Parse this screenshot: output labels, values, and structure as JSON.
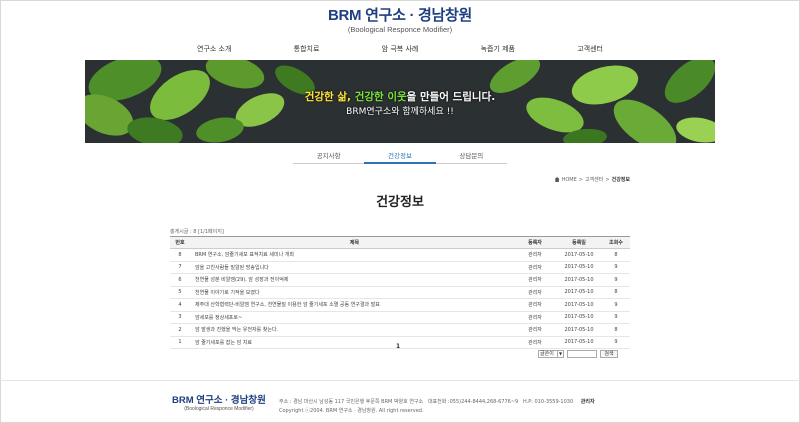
{
  "header": {
    "logo_title": "BRM 연구소 · 경남창원",
    "logo_sub": "(Boological Responce Modifier)"
  },
  "nav": [
    "연구소 소개",
    "통합치료",
    "암 극복 사례",
    "녹즙기 제품",
    "고객센터"
  ],
  "banner": {
    "line1_a": "건강한 삶, ",
    "line1_b": "건강한 이웃",
    "line1_c": "을 만들어 드립니다.",
    "line2": "BRM연구소와 함께하세요 !!"
  },
  "subtabs": [
    "공지사항",
    "건강정보",
    "상담문의"
  ],
  "breadcrumb": [
    "HOME",
    "고객센터",
    "건강정보"
  ],
  "page_title": "건강정보",
  "count": "총게시글 : 8 [1/1페이지]",
  "table": {
    "headers": [
      "번호",
      "제목",
      "등록자",
      "등록일",
      "조회수"
    ],
    "rows": [
      {
        "no": "8",
        "title": "BRM 연구소, 암줄기세포 표적치료 세미나 개최",
        "author": "관리자",
        "date": "2017-05-10",
        "views": "8"
      },
      {
        "no": "7",
        "title": "암을 고친사람들 밀알된 방송입니다",
        "author": "관리자",
        "date": "2017-05-10",
        "views": "9"
      },
      {
        "no": "6",
        "title": "천연물 성분 비알엠(29), 암 성장과 전이억제",
        "author": "관리자",
        "date": "2017-05-10",
        "views": "9"
      },
      {
        "no": "5",
        "title": "천연물 이야기로 기적을 보였다",
        "author": "관리자",
        "date": "2017-05-10",
        "views": "8"
      },
      {
        "no": "4",
        "title": "제주대 산학협력단-비알엠 연구소, 천연물질 이용한 암 줄기세포 소멸 공동 연구결과 발표",
        "author": "관리자",
        "date": "2017-05-10",
        "views": "9"
      },
      {
        "no": "3",
        "title": "암세포를 정상세포로~",
        "author": "관리자",
        "date": "2017-05-10",
        "views": "9"
      },
      {
        "no": "2",
        "title": "암 발생과 진행을 막는 유전자를 찾는다.",
        "author": "관리자",
        "date": "2017-05-10",
        "views": "8"
      },
      {
        "no": "1",
        "title": "암 줄기세포를 잡는 암 치료",
        "author": "관리자",
        "date": "2017-05-10",
        "views": "9"
      }
    ]
  },
  "pager": "1",
  "search": {
    "select_value": "글쓴이",
    "button": "검색"
  },
  "footer": {
    "logo_title": "BRM 연구소 · 경남창원",
    "logo_sub": "(Boological Responce Modifier)",
    "address": "주소 : 경남 마산시 남성동 117 국민은행 후문쪽 BRM 박양호 연구소",
    "phone": "대표전화 :055)244-8444,268-6776~9",
    "mobile": "H.P: 010-3559-1030",
    "admin": "관리자",
    "copyright": "Copyright ⓒ2004. BRM 연구소 · 경남창원. All right reserved."
  }
}
